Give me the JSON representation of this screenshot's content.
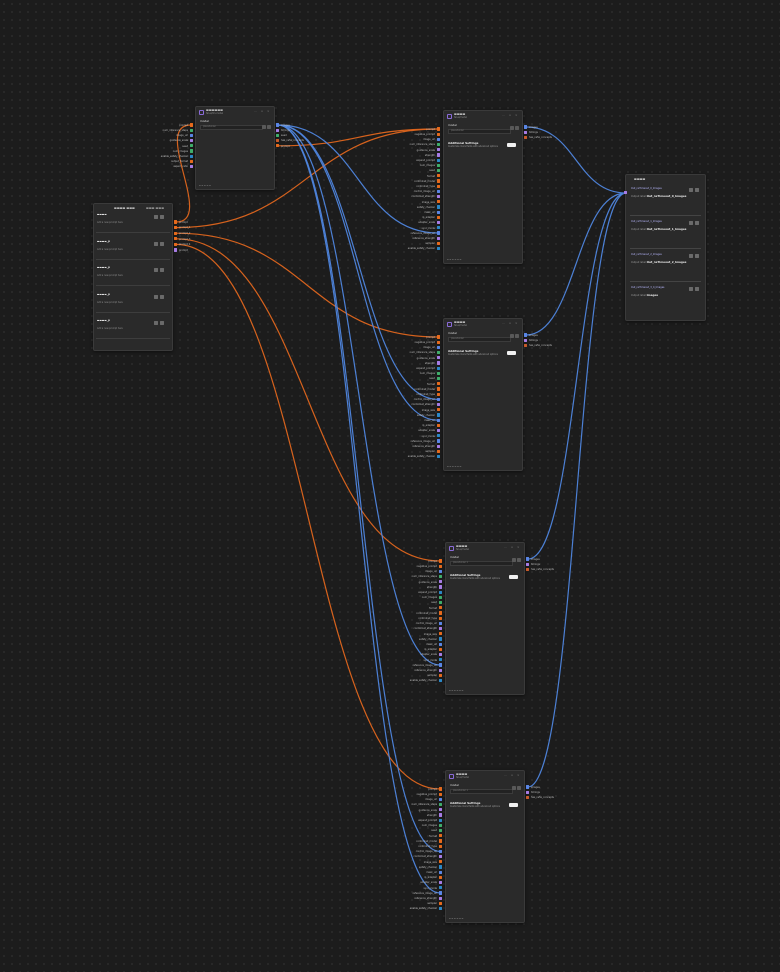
{
  "colors": {
    "prompt_wire": "#e0661d",
    "image_wire": "#4f86df",
    "string_port": "#e66a1c",
    "int_port": "#3fae6a",
    "float_port": "#a77ce6",
    "bool_port": "#2b88c8",
    "image_port": "#5a86e6",
    "model_port": "#c85a2a"
  },
  "generator_inputs": [
    {
      "name": "prompt",
      "type": "string_port"
    },
    {
      "name": "negative_prompt",
      "type": "string_port"
    },
    {
      "name": "image_url",
      "type": "image_port"
    },
    {
      "name": "num_inference_steps",
      "type": "int_port"
    },
    {
      "name": "guidance_scale",
      "type": "float_port"
    },
    {
      "name": "strength",
      "type": "float_port"
    },
    {
      "name": "expand_prompt",
      "type": "bool_port"
    },
    {
      "name": "num_images",
      "type": "int_port"
    },
    {
      "name": "seed",
      "type": "int_port"
    },
    {
      "name": "format",
      "type": "string_port"
    },
    {
      "name": "controlnet_model",
      "type": "string_port"
    },
    {
      "name": "controlnet_type",
      "type": "string_port"
    },
    {
      "name": "control_image_url",
      "type": "image_port"
    },
    {
      "name": "controlnet_strength",
      "type": "float_port"
    },
    {
      "name": "image_size",
      "type": "string_port"
    },
    {
      "name": "safety_checker",
      "type": "bool_port"
    },
    {
      "name": "mask_url",
      "type": "image_port"
    },
    {
      "name": "ip_adapter",
      "type": "string_port"
    },
    {
      "name": "adapter_scale",
      "type": "float_port"
    },
    {
      "name": "sync_mode",
      "type": "bool_port"
    },
    {
      "name": "reference_image_url",
      "type": "image_port"
    },
    {
      "name": "reference_strength",
      "type": "float_port"
    },
    {
      "name": "sampler",
      "type": "string_port"
    },
    {
      "name": "enable_safety_checker",
      "type": "bool_port"
    }
  ],
  "generator_outputs": [
    {
      "name": "images",
      "type": "image_port"
    },
    {
      "name": "timings",
      "type": "float_port"
    },
    {
      "name": "has_nsfw_concepts",
      "type": "model_port"
    }
  ],
  "generators": [
    {
      "title": "▬▬▬▬",
      "subtitle": "fal-ai/model",
      "field_label": "model",
      "field_placeholder": "placeholder",
      "adv_title": "Additional Settings",
      "adv_desc": "Customize more fields with advanced options",
      "footer": "▬ ▬ ▬ ▬ ▬ ▬"
    },
    {
      "title": "▬▬▬▬",
      "subtitle": "fal-ai/model",
      "field_label": "model",
      "field_placeholder": "placeholder",
      "adv_title": "Additional Settings",
      "adv_desc": "Customize more fields with advanced options",
      "footer": "▬ ▬ ▬ ▬ ▬ ▬"
    },
    {
      "title": "▬▬▬▬",
      "subtitle": "fal-ai/model",
      "field_label": "model",
      "field_placeholder": "placeholder 1",
      "adv_title": "Additional Settings",
      "adv_desc": "Customize more fields with advanced options",
      "footer": "▬ ▬ ▬ ▬ ▬ ▬"
    },
    {
      "title": "▬▬▬▬",
      "subtitle": "fal-ai/model",
      "field_label": "model",
      "field_placeholder": "placeholder 1",
      "adv_title": "Additional Settings",
      "adv_desc": "Customize more fields with advanced options",
      "footer": "▬ ▬ ▬ ▬ ▬ ▬"
    }
  ],
  "prompt_node": {
    "title": "▬▬▬▬ ▬▬▬",
    "header_right": "▬▬▬ ▬▬▬",
    "entries": [
      {
        "label": "▬▬▬▬",
        "hint": "Add a new prompt here"
      },
      {
        "label": "▬▬▬▬_p",
        "hint": "Add a new prompt here"
      },
      {
        "label": "▬▬▬▬_p",
        "hint": "Add a new prompt here"
      },
      {
        "label": "▬▬▬▬_p",
        "hint": "Add a new prompt here"
      },
      {
        "label": "▬▬▬▬_p",
        "hint": "Add a new prompt here"
      }
    ],
    "outputs": [
      "prompt",
      "prompt_1",
      "prompt_2",
      "prompt_3",
      "prompt_4",
      "prompt"
    ]
  },
  "llm_node": {
    "title": "▬▬▬▬▬▬",
    "subtitle": "fal-ai/llm-model",
    "field_label": "model",
    "field_placeholder": "placeholder",
    "inputs": [
      "prompt",
      "num_inference_steps",
      "image_url",
      "guidance_scale",
      "seed",
      "num_images",
      "enable_safety_checker",
      "output_format",
      "aspect_ratio"
    ],
    "outputs": [
      "images",
      "timings",
      "seed",
      "has_nsfw_concepts",
      "prompt"
    ]
  },
  "results_node": {
    "title": "▬▬▬▬",
    "items": [
      {
        "label": "Out_nsTimeout_0_Images",
        "prefix": "Output label",
        "value": "Out_nsTimeout_0_Images"
      },
      {
        "label": "Out_nsTimeout_1_Images",
        "prefix": "Output label",
        "value": "Out_nsTimeout_1_Images"
      },
      {
        "label": "Out_nsTimeout_2_Images",
        "prefix": "Output label",
        "value": "Out_nsTimeout_2_Images"
      },
      {
        "label": "Out_nsTimeout_3_4_Images",
        "prefix": "Output label",
        "value": "Images"
      }
    ]
  }
}
